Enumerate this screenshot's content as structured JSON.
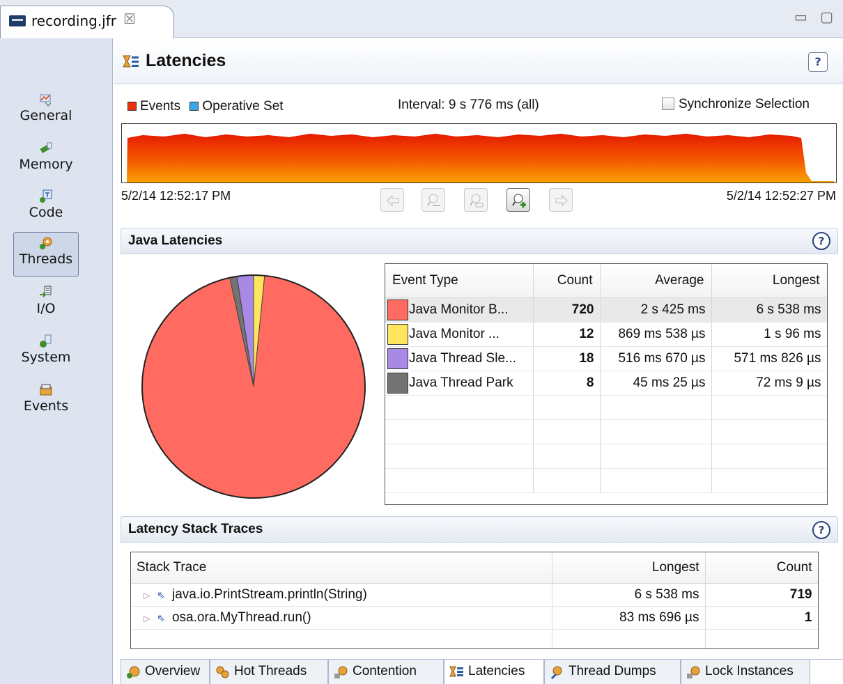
{
  "editor_tab": {
    "label": "recording.jfr",
    "close": "☒"
  },
  "window_controls": "▭ ▢",
  "nav": {
    "items": [
      {
        "label": "General"
      },
      {
        "label": "Memory"
      },
      {
        "label": "Code"
      },
      {
        "label": "Threads",
        "selected": true
      },
      {
        "label": "I/O"
      },
      {
        "label": "System"
      },
      {
        "label": "Events"
      }
    ]
  },
  "header": {
    "title": "Latencies",
    "help": "?"
  },
  "legend": {
    "events": "Events",
    "operative_set": "Operative Set",
    "events_color": "#e8300a",
    "operative_color": "#3aa8e8"
  },
  "interval_label": "Interval: 9 s 776 ms (all)",
  "synchronize_label": "Synchronize Selection",
  "time_range": {
    "start": "5/2/14 12:52:17 PM",
    "end": "5/2/14 12:52:27 PM"
  },
  "java_latencies": {
    "title": "Java Latencies",
    "columns": [
      "Event Type",
      "Count",
      "Average",
      "Longest"
    ],
    "rows": [
      {
        "color": "#ff6b61",
        "event_type": "Java Monitor B...",
        "count": "720",
        "average": "2 s 425 ms",
        "longest": "6 s 538 ms"
      },
      {
        "color": "#ffe45e",
        "event_type": "Java Monitor ...",
        "count": "12",
        "average": "869 ms 538 µs",
        "longest": "1 s 96 ms"
      },
      {
        "color": "#a989e6",
        "event_type": "Java Thread Sle...",
        "count": "18",
        "average": "516 ms 670 µs",
        "longest": "571 ms 826 µs"
      },
      {
        "color": "#737373",
        "event_type": "Java Thread Park",
        "count": "8",
        "average": "45 ms 25 µs",
        "longest": "72 ms 9 µs"
      }
    ]
  },
  "stack_traces": {
    "title": "Latency Stack Traces",
    "columns": [
      "Stack Trace",
      "Longest",
      "Count"
    ],
    "rows": [
      {
        "trace": "java.io.PrintStream.println(String)",
        "longest": "6 s 538 ms",
        "count": "719"
      },
      {
        "trace": "osa.ora.MyThread.run()",
        "longest": "83 ms 696 µs",
        "count": "1"
      }
    ]
  },
  "bottom_tabs": [
    {
      "label": "Overview"
    },
    {
      "label": "Hot Threads"
    },
    {
      "label": "Contention"
    },
    {
      "label": "Latencies",
      "active": true
    },
    {
      "label": "Thread Dumps"
    },
    {
      "label": "Lock Instances"
    }
  ],
  "chart_data": {
    "type": "pie",
    "categories": [
      "Java Monitor B...",
      "Java Monitor ...",
      "Java Thread Sle...",
      "Java Thread Park"
    ],
    "values": [
      720,
      12,
      18,
      8
    ],
    "colors": [
      "#ff6b61",
      "#ffe45e",
      "#a989e6",
      "#737373"
    ]
  }
}
